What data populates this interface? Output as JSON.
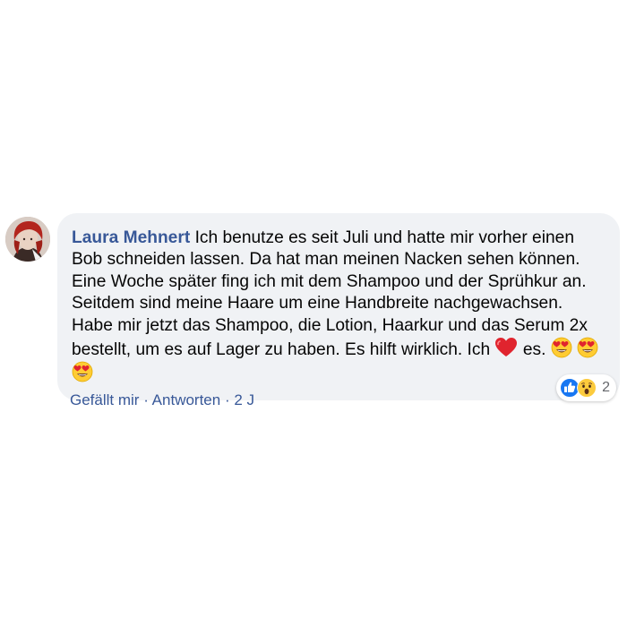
{
  "comment": {
    "author": "Laura Mehnert",
    "text_before_heart": "Ich benutze es seit Juli und hatte mir vorher einen Bob schneiden lassen. Da hat man meinen Nacken sehen können. Eine Woche später fing ich mit dem Shampoo und der Sprühkur an. Seitdem sind meine Haare um eine Handbreite nachgewachsen. Habe mir jetzt das Shampoo, die Lotion, Haarkur und das Serum 2x bestellt, um es auf Lager zu haben. Es hilft wirklich. Ich",
    "text_after_heart": "es.",
    "heart_icon": "red-heart-emoji",
    "trailing_emojis": [
      "heart-eyes-emoji",
      "heart-eyes-emoji",
      "heart-eyes-emoji"
    ]
  },
  "reactions": {
    "icons": [
      "like-icon",
      "wow-icon"
    ],
    "count": "2"
  },
  "actions": {
    "like_label": "Gefällt mir",
    "separator": "·",
    "reply_label": "Antworten",
    "time": "2 J"
  },
  "colors": {
    "author": "#385898",
    "bubble": "#f0f2f5",
    "like_blue": "#1877f2",
    "heart_red": "#e0242e"
  }
}
